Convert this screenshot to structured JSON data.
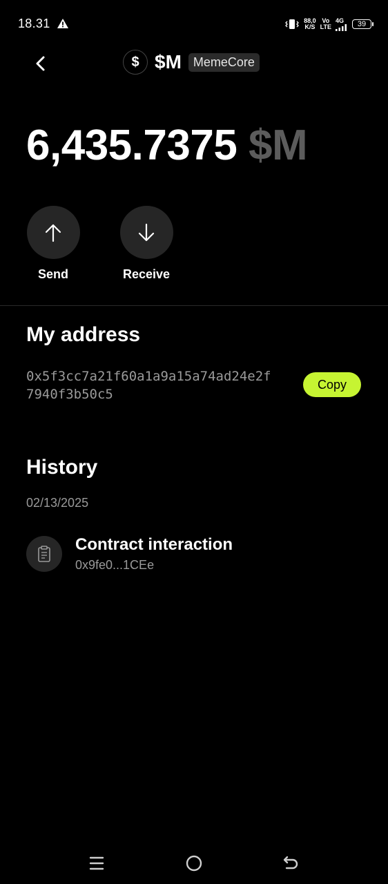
{
  "status_bar": {
    "time": "18.31",
    "net_speed_top": "88,0",
    "net_speed_bottom": "K/S",
    "volte_top": "Vo",
    "volte_bottom": "LTE",
    "network": "4G",
    "battery": "39"
  },
  "header": {
    "token_logo_symbol": "$",
    "token_symbol": "$M",
    "chain_badge": "MemeCore"
  },
  "balance": {
    "amount": "6,435.7375",
    "unit": "$M"
  },
  "actions": {
    "send_label": "Send",
    "receive_label": "Receive"
  },
  "address_section": {
    "title": "My address",
    "address": "0x5f3cc7a21f60a1a9a15a74ad24e2f7940f3b50c5",
    "copy_label": "Copy"
  },
  "history": {
    "title": "History",
    "groups": [
      {
        "date": "02/13/2025",
        "items": [
          {
            "title": "Contract interaction",
            "subtitle": "0x9fe0...1CEe",
            "icon": "clipboard-icon"
          }
        ]
      }
    ]
  },
  "colors": {
    "background": "#000000",
    "accent": "#c6f432",
    "muted_text": "#9a9a9a",
    "circle_bg": "#262626"
  }
}
